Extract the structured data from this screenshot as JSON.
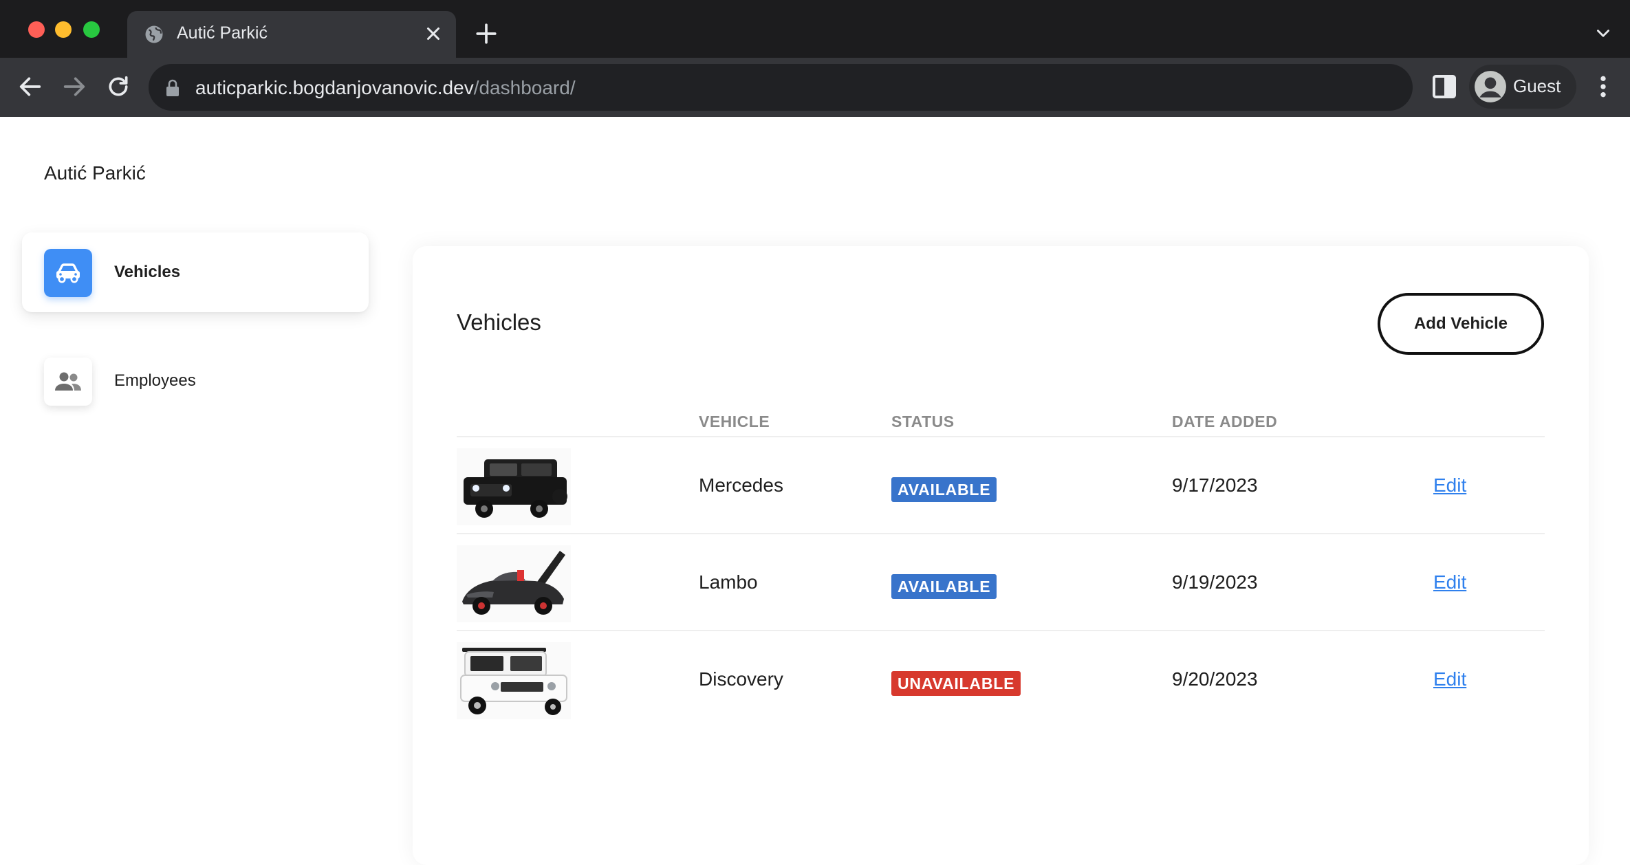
{
  "browser": {
    "tab_title": "Autić Parkić",
    "url_host": "auticparkic.bogdanjovanovic.dev",
    "url_path": "/dashboard/",
    "profile_label": "Guest"
  },
  "app": {
    "brand": "Autić Parkić"
  },
  "sidebar": {
    "items": [
      {
        "label": "Vehicles",
        "icon": "car-icon",
        "active": true
      },
      {
        "label": "Employees",
        "icon": "people-icon",
        "active": false
      }
    ]
  },
  "main": {
    "title": "Vehicles",
    "add_button_label": "Add Vehicle",
    "columns": [
      "VEHICLE",
      "STATUS",
      "DATE ADDED"
    ],
    "rows": [
      {
        "image": "black-jeep-thumbnail",
        "vehicle": "Mercedes",
        "status": "AVAILABLE",
        "date": "9/17/2023",
        "action": "Edit"
      },
      {
        "image": "black-supercar-thumbnail",
        "vehicle": "Lambo",
        "status": "AVAILABLE",
        "date": "9/19/2023",
        "action": "Edit"
      },
      {
        "image": "white-suv-thumbnail",
        "vehicle": "Discovery",
        "status": "UNAVAILABLE",
        "date": "9/20/2023",
        "action": "Edit"
      }
    ]
  },
  "colors": {
    "available": "#3874cb",
    "unavailable": "#d7392d",
    "accent": "#3f8ef5",
    "link": "#2f80ed"
  }
}
